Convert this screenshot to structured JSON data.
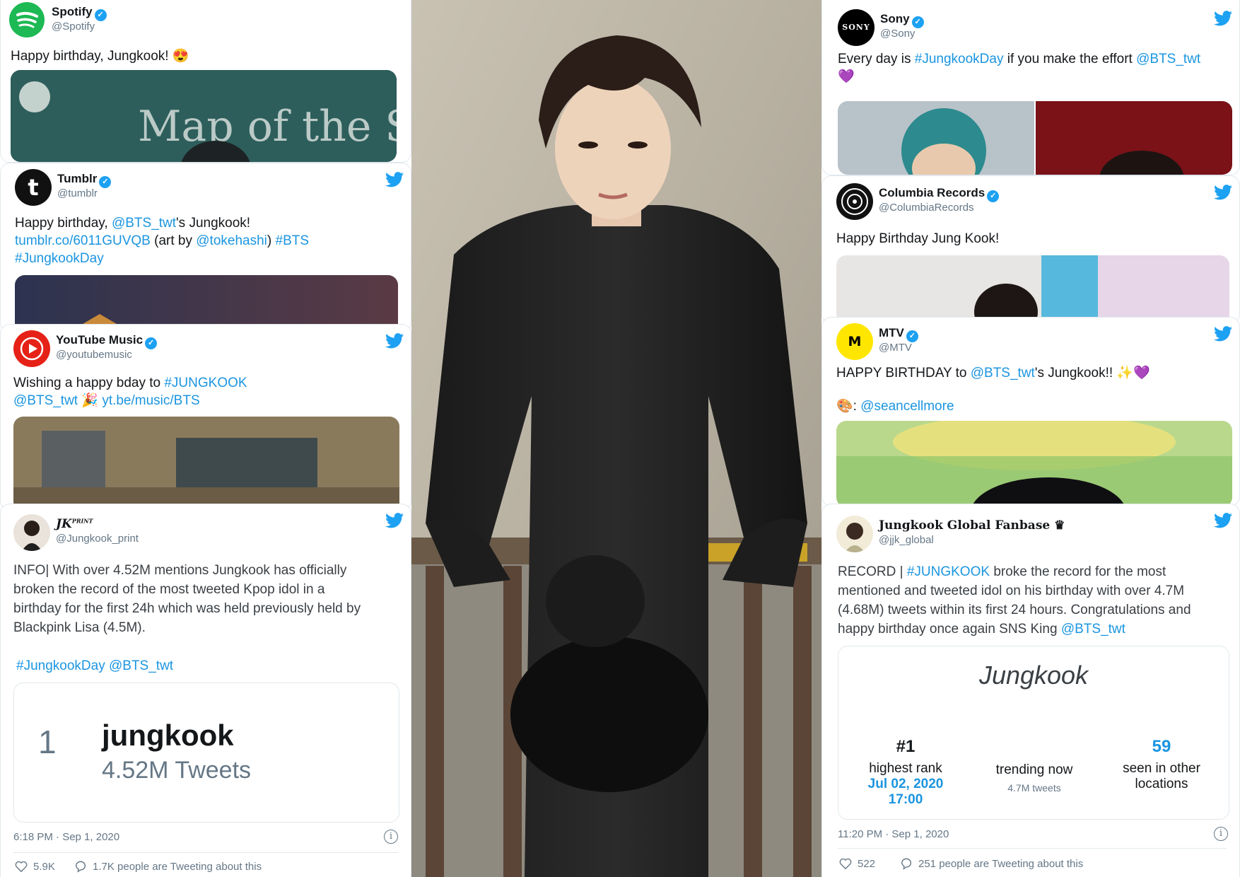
{
  "spotify": {
    "name": "Spotify",
    "handle": "@Spotify",
    "text": "Happy birthday, Jungkook! 😍",
    "media_text": "Map of the S"
  },
  "tumblr": {
    "name": "Tumblr",
    "handle": "@tumblr",
    "line1a": "Happy birthday, ",
    "line1b": "@BTS_twt",
    "line1c": "'s Jungkook!",
    "line2a": "tumblr.co/6011GUVQB",
    "line2b": " (art by ",
    "line2c": "@tokehashi",
    "line2d": ") ",
    "line2e": "#BTS",
    "line3": "#JungkookDay"
  },
  "youtube": {
    "name": "YouTube Music",
    "handle": "@youtubemusic",
    "line1a": "Wishing a happy bday to ",
    "line1b": "#JUNGKOOK",
    "line2a": "@BTS_twt",
    "line2b": " 🎉 ",
    "line2c": "yt.be/music/BTS"
  },
  "jkprint": {
    "name": "JK",
    "name_sup": "PRINT",
    "handle": "@Jungkook_print",
    "lines": [
      "INFO| With over 4.52M mentions Jungkook has officially",
      "broken the record of the most tweeted Kpop idol in a",
      "birthday for the first 24h which was held previously held by",
      "Blackpink Lisa (4.5M)."
    ],
    "tags_a": "#JungkookDay",
    "tags_b": "@BTS_twt",
    "rank": "1",
    "trend_name": "jungkook",
    "trend_count": "4.52M Tweets",
    "timestamp": "6:18 PM · Sep 1, 2020",
    "likes": "5.9K",
    "talking": "1.7K people are Tweeting about this"
  },
  "sony": {
    "name": "Sony",
    "handle": "@Sony",
    "line1a": "Every day is ",
    "line1b": "#JungkookDay",
    "line1c": " if you make the effort ",
    "line1d": "@BTS_twt",
    "line2": "💜"
  },
  "columbia": {
    "name": "Columbia Records",
    "handle": "@ColumbiaRecords",
    "text": "Happy Birthday Jung Kook!"
  },
  "mtv": {
    "name": "MTV",
    "handle": "@MTV",
    "line1a": "HAPPY BIRTHDAY to ",
    "line1b": "@BTS_twt",
    "line1c": "'s Jungkook!! ✨💜",
    "line2a": "🎨: ",
    "line2b": "@seancellmore"
  },
  "fanbase": {
    "name": "Jungkook Global Fanbase ♛",
    "handle": "@jjk_global",
    "line1a": "RECORD | ",
    "line1b": "#JUNGKOOK",
    "line1c": " broke the record for the most",
    "line2": "mentioned and tweeted idol on his birthday with over 4.7M",
    "line3": "(4.68M) tweets within its first 24 hours. Congratulations and",
    "line4a": "happy birthday once again SNS King ",
    "line4b": "@BTS_twt",
    "trend_title": "Jungkook",
    "stat1_value": "#1",
    "stat1_label": "highest rank",
    "stat1_date": "Jul 02, 2020",
    "stat1_time": "17:00",
    "stat2_label": "trending now",
    "stat2_sub": "4.7M tweets",
    "stat3_value": "59",
    "stat3_label1": "seen in other",
    "stat3_label2": "locations",
    "timestamp": "11:20 PM · Sep 1, 2020",
    "likes": "522",
    "talking": "251 people are Tweeting about this"
  },
  "colors": {
    "twitter_blue": "#1da1f2",
    "link_blue": "#1b95e0",
    "spotify_green": "#1db954",
    "youtube_red": "#e62117",
    "mtv_yellow": "#ffe600"
  }
}
